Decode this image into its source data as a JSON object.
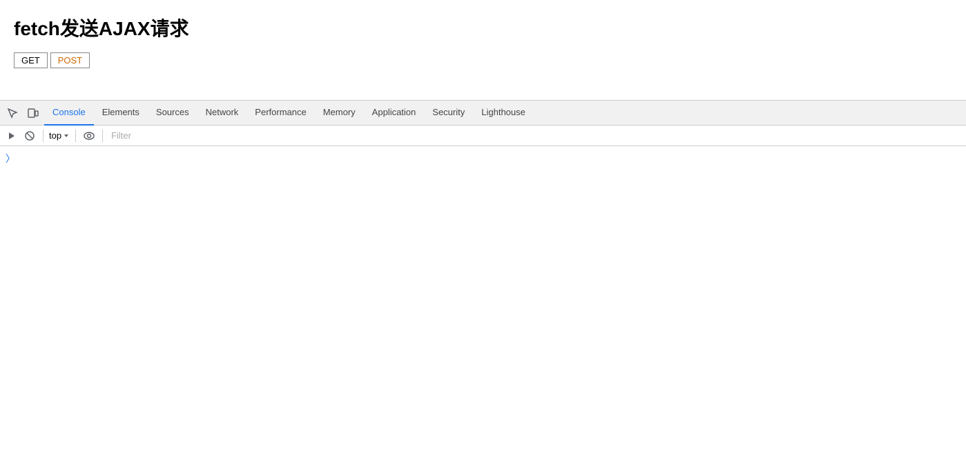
{
  "page": {
    "title": "fetch发送AJAX请求"
  },
  "buttons": {
    "get_label": "GET",
    "post_label": "POST"
  },
  "devtools": {
    "tabs": [
      {
        "id": "console",
        "label": "Console",
        "active": true
      },
      {
        "id": "elements",
        "label": "Elements",
        "active": false
      },
      {
        "id": "sources",
        "label": "Sources",
        "active": false
      },
      {
        "id": "network",
        "label": "Network",
        "active": false
      },
      {
        "id": "performance",
        "label": "Performance",
        "active": false
      },
      {
        "id": "memory",
        "label": "Memory",
        "active": false
      },
      {
        "id": "application",
        "label": "Application",
        "active": false
      },
      {
        "id": "security",
        "label": "Security",
        "active": false
      },
      {
        "id": "lighthouse",
        "label": "Lighthouse",
        "active": false
      }
    ],
    "toolbar": {
      "context_label": "top",
      "filter_placeholder": "Filter"
    }
  },
  "colors": {
    "active_tab": "#1a73e8",
    "post_button": "#cc6600"
  }
}
